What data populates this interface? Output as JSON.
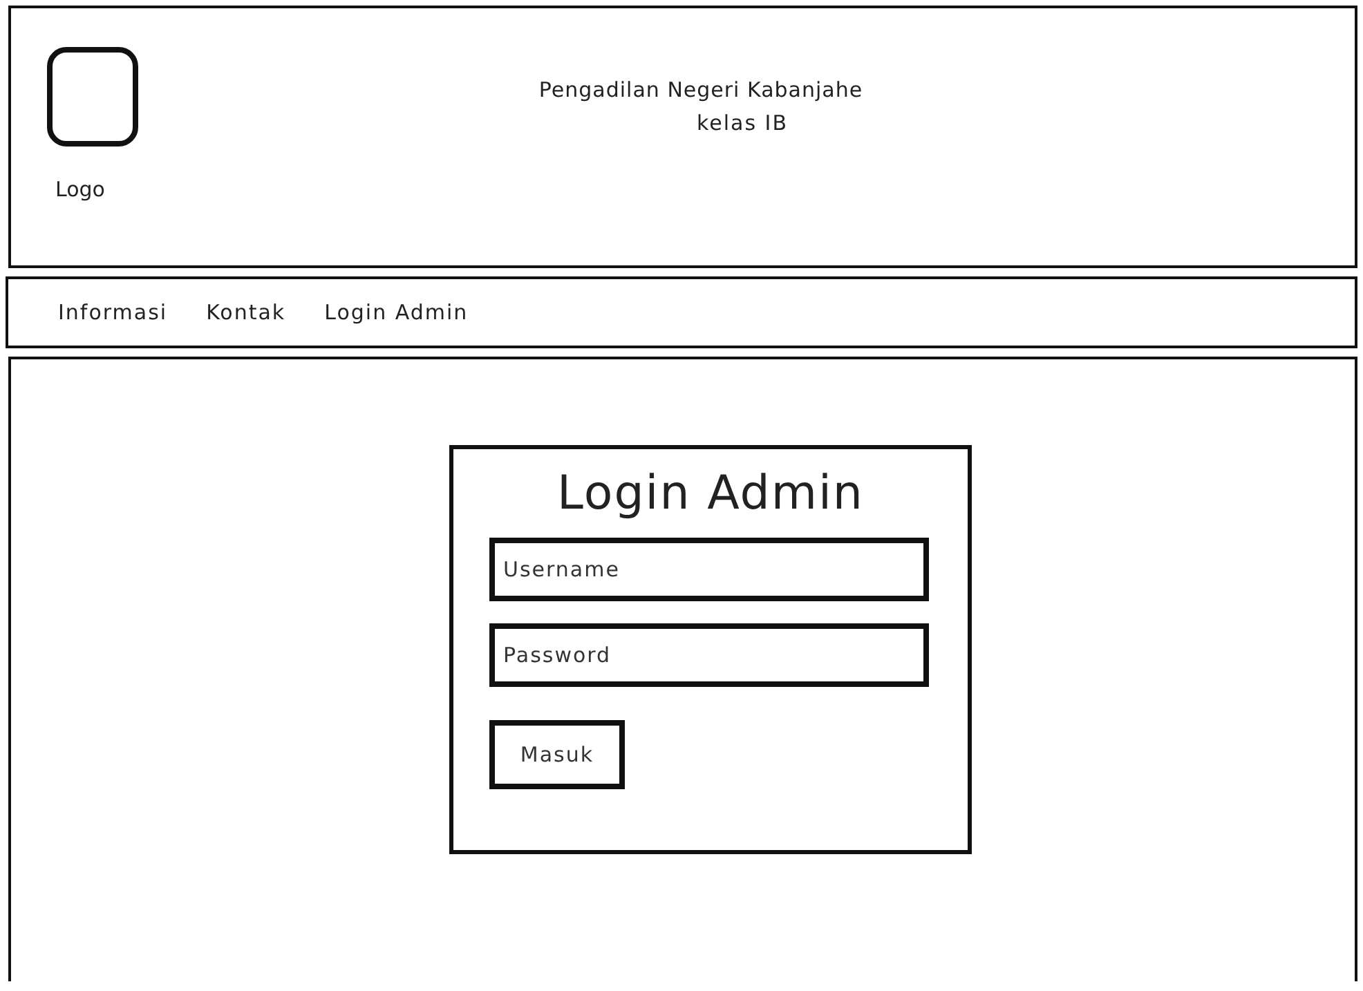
{
  "header": {
    "logo_label": "Logo",
    "title": "Pengadilan Negeri Kabanjahe",
    "subtitle": "kelas IB"
  },
  "nav": {
    "items": [
      "Informasi",
      "Kontak",
      "Login Admin"
    ]
  },
  "login": {
    "title": "Login Admin",
    "fields": [
      {
        "placeholder": "Username"
      },
      {
        "placeholder": "Password"
      }
    ],
    "button": "Masuk"
  }
}
